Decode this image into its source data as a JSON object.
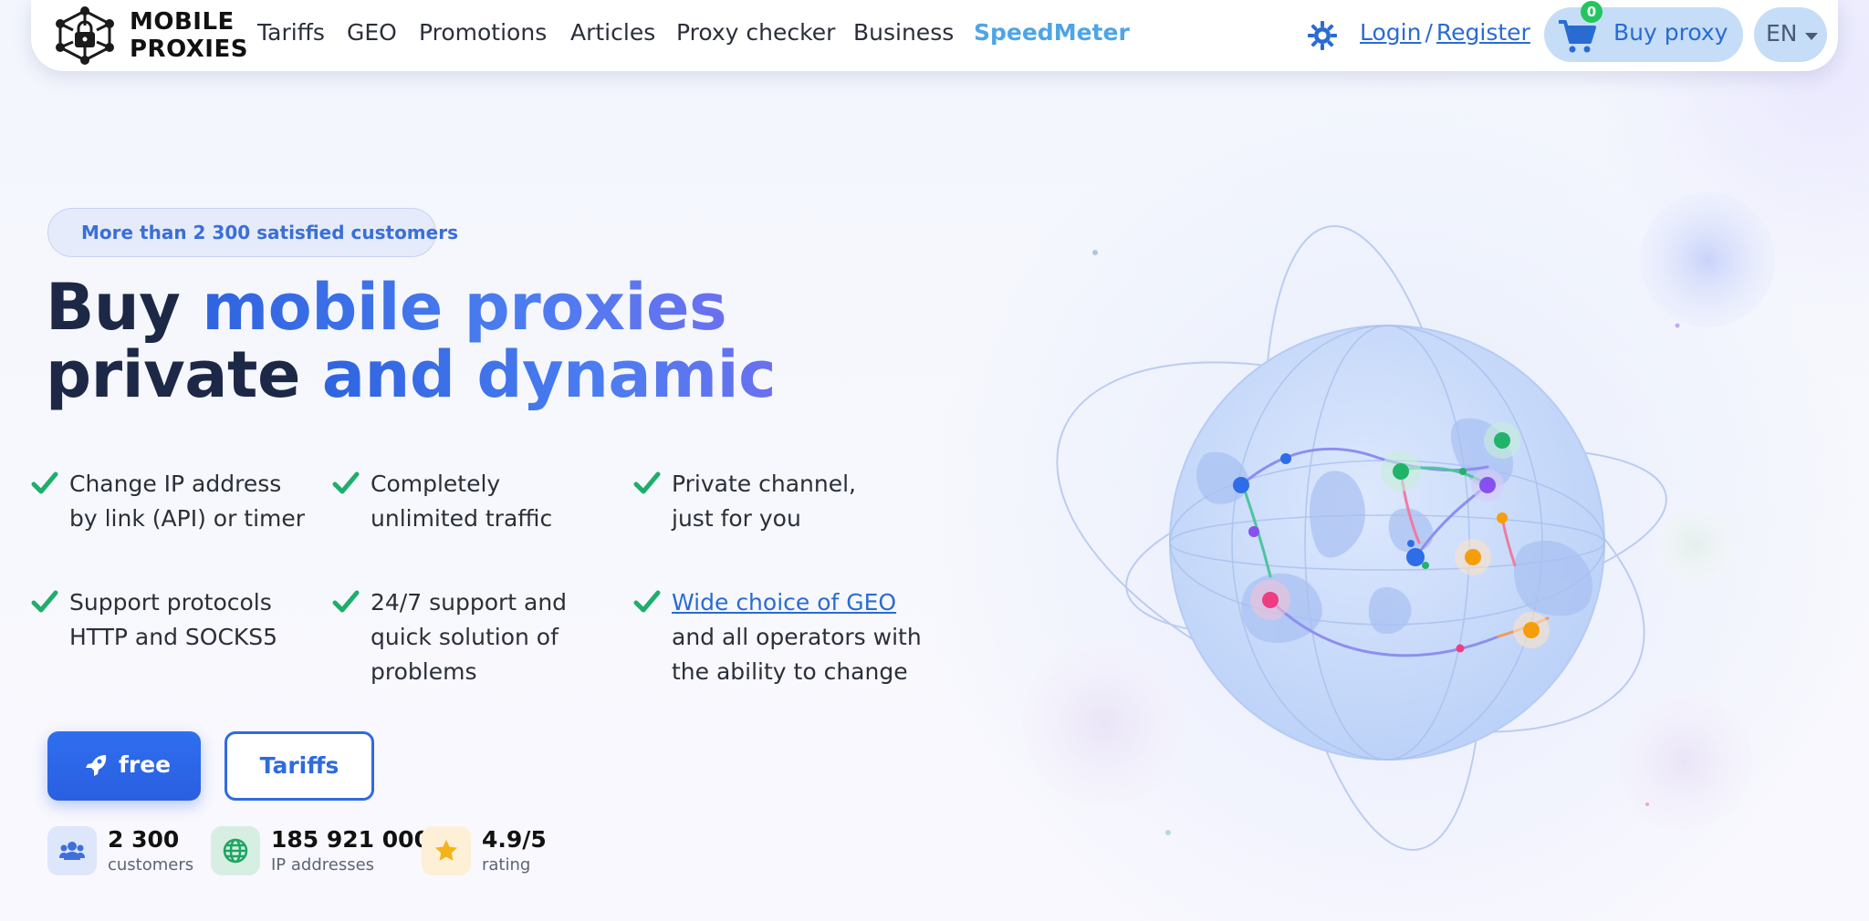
{
  "brand": {
    "line1": "MOBILE",
    "line2": "PROXIES"
  },
  "nav": {
    "links": [
      "Tariffs",
      "GEO",
      "Promotions",
      "Articles",
      "Proxy checker",
      "Business"
    ],
    "accent_link": "SpeedMeter",
    "login": "Login",
    "separator": "/",
    "register": "Register",
    "cart_count": "0",
    "buy_label": "Buy proxy",
    "language": "EN",
    "theme_icon": "gear-sun-icon",
    "cart_icon": "cart-icon"
  },
  "hero": {
    "pill": "More than 2 300 satisfied customers",
    "title_line1_dark": "Buy ",
    "title_line1_blue": "mobile proxies",
    "title_line2_dark": "private ",
    "title_line2_blue": "and dynamic",
    "features": [
      {
        "lines": [
          "Change IP address",
          "by link (API) or timer"
        ]
      },
      {
        "lines": [
          "Completely",
          "unlimited traffic"
        ]
      },
      {
        "lines": [
          "Private channel,",
          "just for you"
        ]
      },
      {
        "lines": [
          "Support protocols",
          "HTTP and SOCKS5"
        ]
      },
      {
        "lines": [
          "24/7 support and",
          "quick solution of",
          "problems"
        ]
      },
      {
        "link": "Wide choice of GEO",
        "lines": [
          "and all operators with",
          "the ability to change"
        ]
      }
    ],
    "buttons": {
      "free": "free",
      "tariffs": "Tariffs"
    },
    "stats": [
      {
        "value": "2 300",
        "caption": "customers",
        "icon": "users-icon"
      },
      {
        "value": "185 921 000",
        "caption": "IP addresses",
        "icon": "globe-icon"
      },
      {
        "value": "4.9/5",
        "caption": "rating",
        "icon": "star-icon"
      }
    ]
  },
  "colors": {
    "primary": "#2f6ae0",
    "accent_link": "#4ea5e6",
    "check_green": "#1fae6a",
    "headline_dark": "#1c2846"
  }
}
